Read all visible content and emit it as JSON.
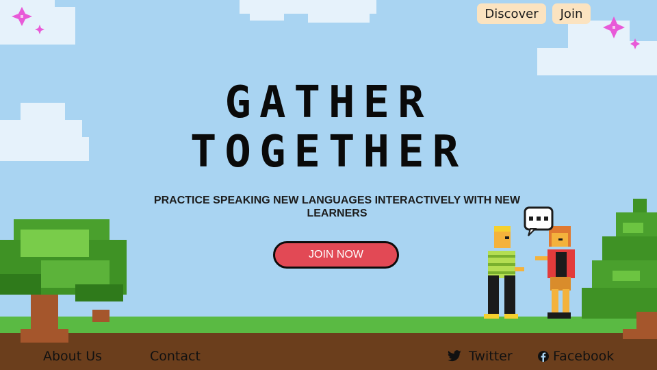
{
  "nav": {
    "discover": "Discover",
    "join": "Join"
  },
  "hero": {
    "title_line1": "GATHER",
    "title_line2": "TOGETHER",
    "subtitle": "PRACTICE SPEAKING NEW LANGUAGES INTERACTIVELY WITH NEW LEARNERS",
    "cta": "JOIN NOW"
  },
  "footer": {
    "about": "About Us",
    "contact": "Contact",
    "twitter": "Twitter",
    "facebook": "Facebook"
  },
  "colors": {
    "sky": "#a9d4f2",
    "grass": "#5aba43",
    "dirt": "#6b3e1c",
    "cta": "#e24955",
    "nav_button": "#fbe3c0"
  },
  "icons": [
    "sparkle-icon",
    "speech-bubble-icon",
    "twitter-icon",
    "facebook-icon"
  ]
}
